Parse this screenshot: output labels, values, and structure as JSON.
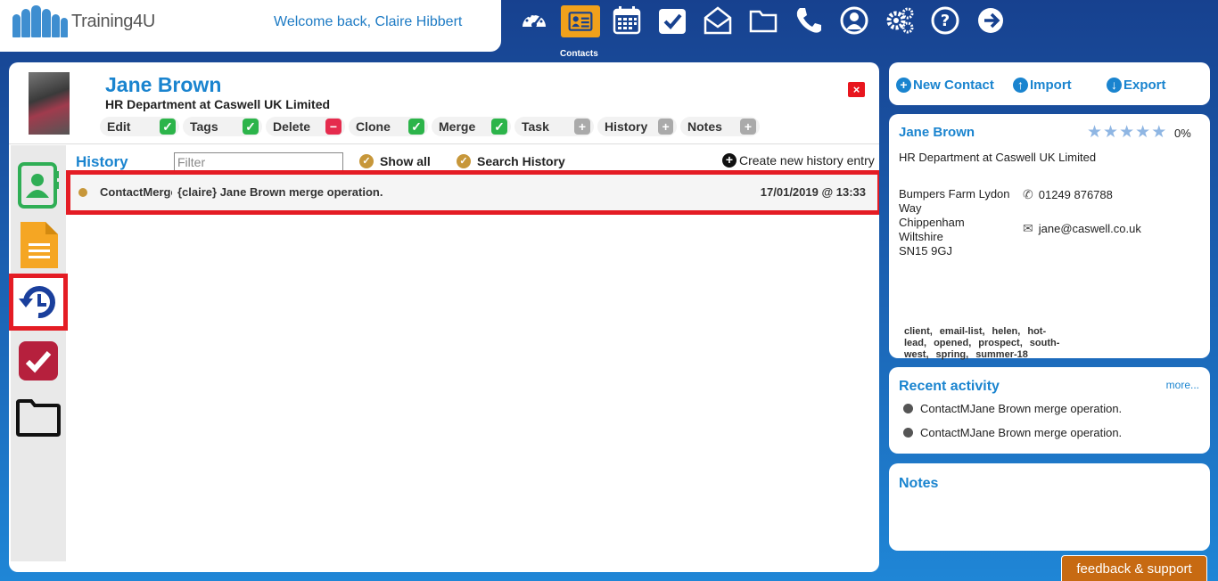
{
  "brand": {
    "name": "Training4U"
  },
  "header": {
    "welcome": "Welcome back, Claire Hibbert",
    "active_nav_label": "Contacts"
  },
  "nav": [
    {
      "name": "dashboard-icon"
    },
    {
      "name": "contacts-icon"
    },
    {
      "name": "calendar-icon"
    },
    {
      "name": "tasks-icon"
    },
    {
      "name": "mail-icon"
    },
    {
      "name": "folder-icon"
    },
    {
      "name": "phone-icon"
    },
    {
      "name": "user-icon"
    },
    {
      "name": "settings-icon"
    },
    {
      "name": "help-icon"
    },
    {
      "name": "logout-icon"
    }
  ],
  "contact": {
    "name": "Jane Brown",
    "department": "HR Department at Caswell UK Limited",
    "close": "×"
  },
  "actions": [
    {
      "label": "Edit",
      "icon": "✓"
    },
    {
      "label": "Tags",
      "icon": "✓"
    },
    {
      "label": "Delete",
      "icon": "−"
    },
    {
      "label": "Clone",
      "icon": "✓"
    },
    {
      "label": "Merge",
      "icon": "✓"
    },
    {
      "label": "Task",
      "icon": "+"
    },
    {
      "label": "History",
      "icon": "+"
    },
    {
      "label": "Notes",
      "icon": "+"
    }
  ],
  "history": {
    "title": "History",
    "filter_placeholder": "Filter",
    "show_all": "Show all",
    "search_history": "Search History",
    "create": "Create new history entry",
    "rows": [
      {
        "type": "ContactMerge",
        "desc": "{claire} Jane Brown merge operation.",
        "date": "17/01/2019 @ 13:33"
      }
    ]
  },
  "right_top": {
    "new_contact": "New Contact",
    "import": "Import",
    "export": "Export"
  },
  "card": {
    "name": "Jane Brown",
    "rating_pct": "0%",
    "department": "HR Department at Caswell UK Limited",
    "address": [
      "Bumpers Farm Lydon Way",
      "Chippenham",
      "Wiltshire",
      "SN15 9GJ"
    ],
    "phone": "01249 876788",
    "email": "jane@caswell.co.uk",
    "tags": [
      "client,",
      "email-list,",
      "helen,",
      "hot-lead,",
      "opened,",
      "prospect,",
      "south-west,",
      "spring,",
      "summer-18"
    ]
  },
  "recent": {
    "title": "Recent activity",
    "more": "more...",
    "items": [
      "ContactMJane Brown merge operation.",
      "ContactMJane Brown merge operation."
    ]
  },
  "notes": {
    "title": "Notes"
  },
  "feedback": "feedback & support"
}
